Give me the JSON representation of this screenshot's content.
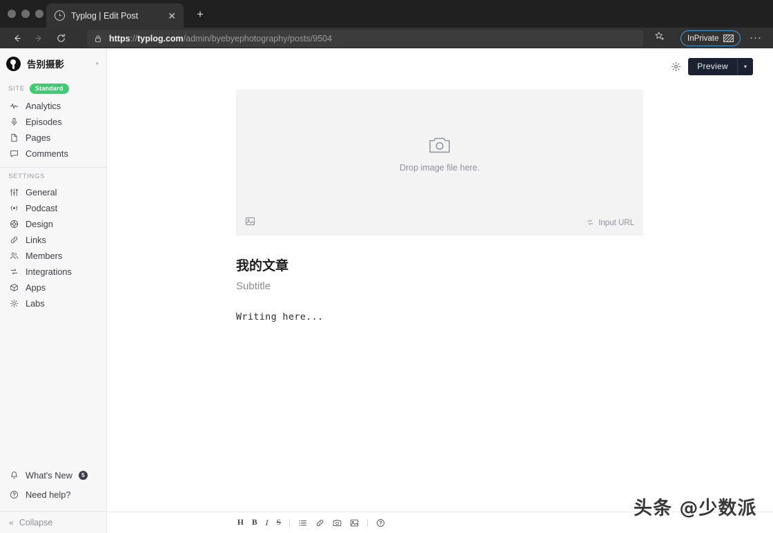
{
  "browser": {
    "tab": {
      "title": "Typlog | Edit Post",
      "favicon": "clock-circle-icon",
      "close": "✕"
    },
    "new_tab": "+",
    "nav": {
      "back": "←",
      "forward": "→",
      "reload": "↻"
    },
    "url": {
      "scheme": "https",
      "sep": "://",
      "host": "typlog.com",
      "path": "/admin/byebyephotography/posts/9504"
    },
    "bookmark_icon": "star-icon",
    "inprivate": {
      "label": "InPrivate",
      "icon": "inprivate-mask-icon",
      "border_color": "#4a9ad4"
    },
    "more": "···"
  },
  "sidebar": {
    "site": {
      "name": "告别摄影",
      "avatar": "site-avatar",
      "chevron": "▾"
    },
    "site_section": {
      "label": "SITE",
      "badge": "Standard",
      "badge_color": "#3ecb72"
    },
    "site_items": [
      {
        "label": "Analytics",
        "icon": "pulse-icon"
      },
      {
        "label": "Episodes",
        "icon": "microphone-icon"
      },
      {
        "label": "Pages",
        "icon": "file-icon"
      },
      {
        "label": "Comments",
        "icon": "comment-icon"
      }
    ],
    "settings_label": "SETTINGS",
    "settings_items": [
      {
        "label": "General",
        "icon": "sliders-icon"
      },
      {
        "label": "Podcast",
        "icon": "broadcast-icon"
      },
      {
        "label": "Design",
        "icon": "palette-icon"
      },
      {
        "label": "Links",
        "icon": "link-icon"
      },
      {
        "label": "Members",
        "icon": "people-icon"
      },
      {
        "label": "Integrations",
        "icon": "sync-icon"
      },
      {
        "label": "Apps",
        "icon": "package-icon"
      },
      {
        "label": "Labs",
        "icon": "gear-flask-icon"
      }
    ],
    "bottom": [
      {
        "label": "What's New",
        "icon": "bell-icon",
        "badge": "5"
      },
      {
        "label": "Need help?",
        "icon": "question-circle-icon"
      }
    ],
    "collapse": {
      "label": "Collapse",
      "icon": "double-chevron-left-icon"
    }
  },
  "topbar": {
    "settings_icon": "gear-icon",
    "preview_label": "Preview",
    "preview_caret": "▾"
  },
  "dropzone": {
    "icon": "camera-icon",
    "text": "Drop image file here.",
    "picker_icon": "image-icon",
    "url_icon": "swap-icon",
    "url_label": "Input URL"
  },
  "post": {
    "title": "我的文章",
    "subtitle": "Subtitle",
    "body": "Writing here..."
  },
  "editor_toolbar": [
    {
      "name": "heading",
      "glyph": "H",
      "kind": "bold"
    },
    {
      "name": "bold",
      "glyph": "B",
      "kind": "bold"
    },
    {
      "name": "italic",
      "glyph": "I",
      "kind": "italic"
    },
    {
      "name": "strikethrough",
      "glyph": "S",
      "kind": "strike"
    },
    {
      "name": "divider-1",
      "glyph": "",
      "kind": "divider"
    },
    {
      "name": "unordered-list",
      "glyph": "",
      "kind": "icon-list"
    },
    {
      "name": "link",
      "glyph": "",
      "kind": "icon-link"
    },
    {
      "name": "camera",
      "glyph": "",
      "kind": "icon-camera"
    },
    {
      "name": "image",
      "glyph": "",
      "kind": "icon-image"
    },
    {
      "name": "divider-2",
      "glyph": "",
      "kind": "divider"
    },
    {
      "name": "help",
      "glyph": "",
      "kind": "icon-help"
    }
  ],
  "watermark": "头条 @少数派"
}
